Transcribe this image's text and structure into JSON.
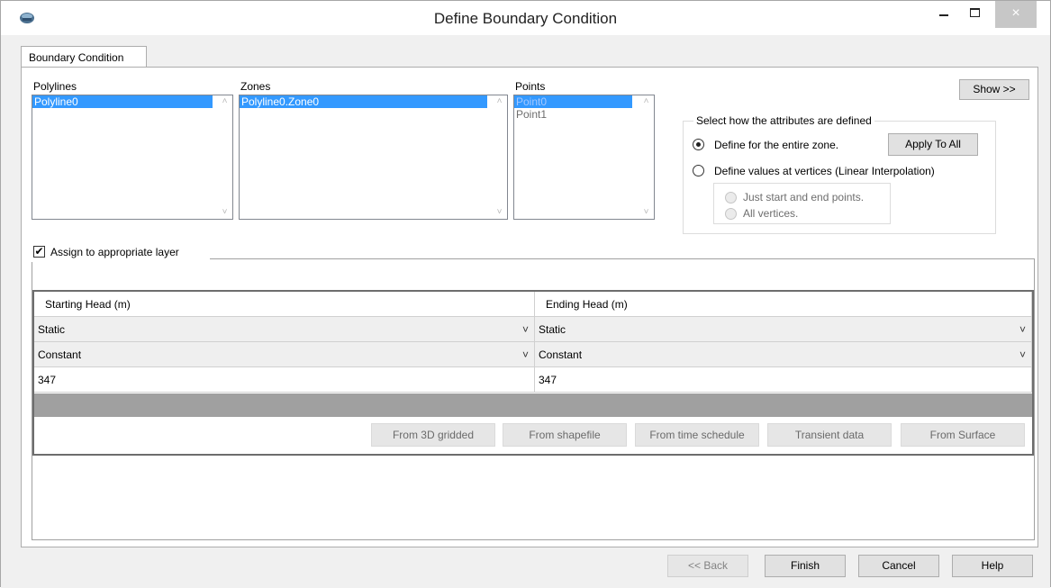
{
  "window": {
    "title": "Define Boundary Condition",
    "minimize_symbol": "",
    "close_symbol": "×"
  },
  "tab": {
    "label": "Boundary Condition"
  },
  "lists": {
    "polylines": {
      "label": "Polylines",
      "items": [
        "Polyline0"
      ]
    },
    "zones": {
      "label": "Zones",
      "items": [
        "Polyline0.Zone0"
      ]
    },
    "points": {
      "label": "Points",
      "items": [
        "Point0",
        "Point1"
      ]
    }
  },
  "show_button": "Show >>",
  "attributes": {
    "group_title": "Select how the attributes are defined",
    "option_entire_zone": "Define for the entire zone.",
    "apply_to_all": "Apply To All",
    "option_vertices": "Define values at vertices (Linear Interpolation)",
    "sub_start_end": "Just start and end points.",
    "sub_all_vertices": "All vertices."
  },
  "assign_layer": {
    "label": "Assign to appropriate layer",
    "checked": true
  },
  "grid": {
    "columns": [
      "Starting Head (m)",
      "Ending Head (m)"
    ],
    "rows": [
      [
        "Static",
        "Static"
      ],
      [
        "Constant",
        "Constant"
      ],
      [
        "347",
        "347"
      ]
    ]
  },
  "import_buttons": [
    "From 3D gridded",
    "From shapefile",
    "From time schedule",
    "Transient data",
    "From Surface"
  ],
  "footer": {
    "back": "<< Back",
    "finish": "Finish",
    "cancel": "Cancel",
    "help": "Help"
  },
  "icons": {
    "app": "app-icon",
    "check": "✔",
    "chevron": "˅",
    "up": "˄"
  }
}
